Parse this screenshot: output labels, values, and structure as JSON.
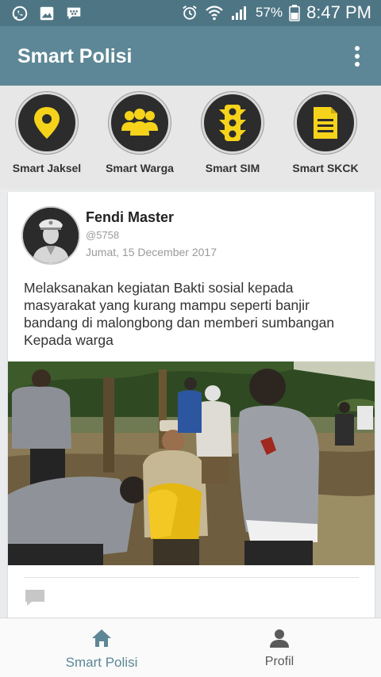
{
  "status_bar": {
    "battery": "57%",
    "time": "8:47 PM"
  },
  "app_bar": {
    "title": "Smart Polisi",
    "menu_icon": "more-vert-icon"
  },
  "shortcuts": [
    {
      "label": "Smart Jaksel",
      "icon": "location-pin-icon"
    },
    {
      "label": "Smart Warga",
      "icon": "people-group-icon"
    },
    {
      "label": "Smart SIM",
      "icon": "traffic-light-icon"
    },
    {
      "label": "Smart SKCK",
      "icon": "document-icon"
    }
  ],
  "post": {
    "author": "Fendi Master",
    "handle": "@5758",
    "date": "Jumat, 15 December 2017",
    "text": "Melaksanakan kegiatan Bakti sosial kepada masyarakat yang kurang mampu seperti banjir bandang di malongbong dan memberi sumbangan Kepada warga",
    "comment_icon": "comment-icon"
  },
  "bottom_nav": {
    "home_label": "Smart Polisi",
    "profile_label": "Profil"
  },
  "colors": {
    "status_bar": "#4e7584",
    "app_bar": "#5d8796",
    "accent_yellow": "#f5d31b",
    "icon_circle": "#2c2c2c"
  }
}
